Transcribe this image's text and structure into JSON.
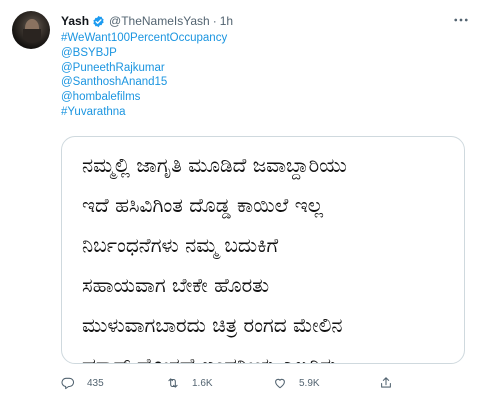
{
  "tweet": {
    "author_name": "Yash",
    "handle": "@TheNameIsYash",
    "separator": "·",
    "time": "1h",
    "lines": [
      "#WeWant100PercentOccupancy",
      "@BSYBJP",
      "@PuneethRajkumar",
      "@SanthoshAnand15",
      "@hombalefilms",
      "#Yuvarathna"
    ],
    "image_text": [
      "ನಮ್ಮಲ್ಲಿ ಜಾಗೃತಿ ಮೂಡಿದೆ ಜವಾಬ್ದಾರಿಯು",
      "ಇದೆ ಹಸಿವಿಗಿಂತ ದೊಡ್ಡ ಕಾಯಿಲೆ ಇಲ್ಲ",
      "ನಿರ್ಬಂಧನೆಗಳು ನಮ್ಮ ಬದುಕಿಗೆ",
      "ಸಹಾಯವಾಗ ಬೇಕೇ ಹೊರತು",
      "ಮುಳುವಾಗಬಾರದು ಚಿತ್ರ ರಂಗದ ಮೇಲಿನ",
      "ಹಠಾತ್ ದೋರಣೆ ಖಂಡನೀಯ ಎಲ್ಲರಿಗು"
    ],
    "actions": {
      "replies": "435",
      "retweets": "1.6K",
      "likes": "5.9K"
    }
  },
  "colors": {
    "link": "#1b95e0",
    "secondary": "#536471",
    "verified": "#1d9bf0"
  },
  "icons": [
    "more-icon",
    "verified-badge-icon",
    "reply-icon",
    "retweet-icon",
    "like-icon",
    "share-icon"
  ]
}
